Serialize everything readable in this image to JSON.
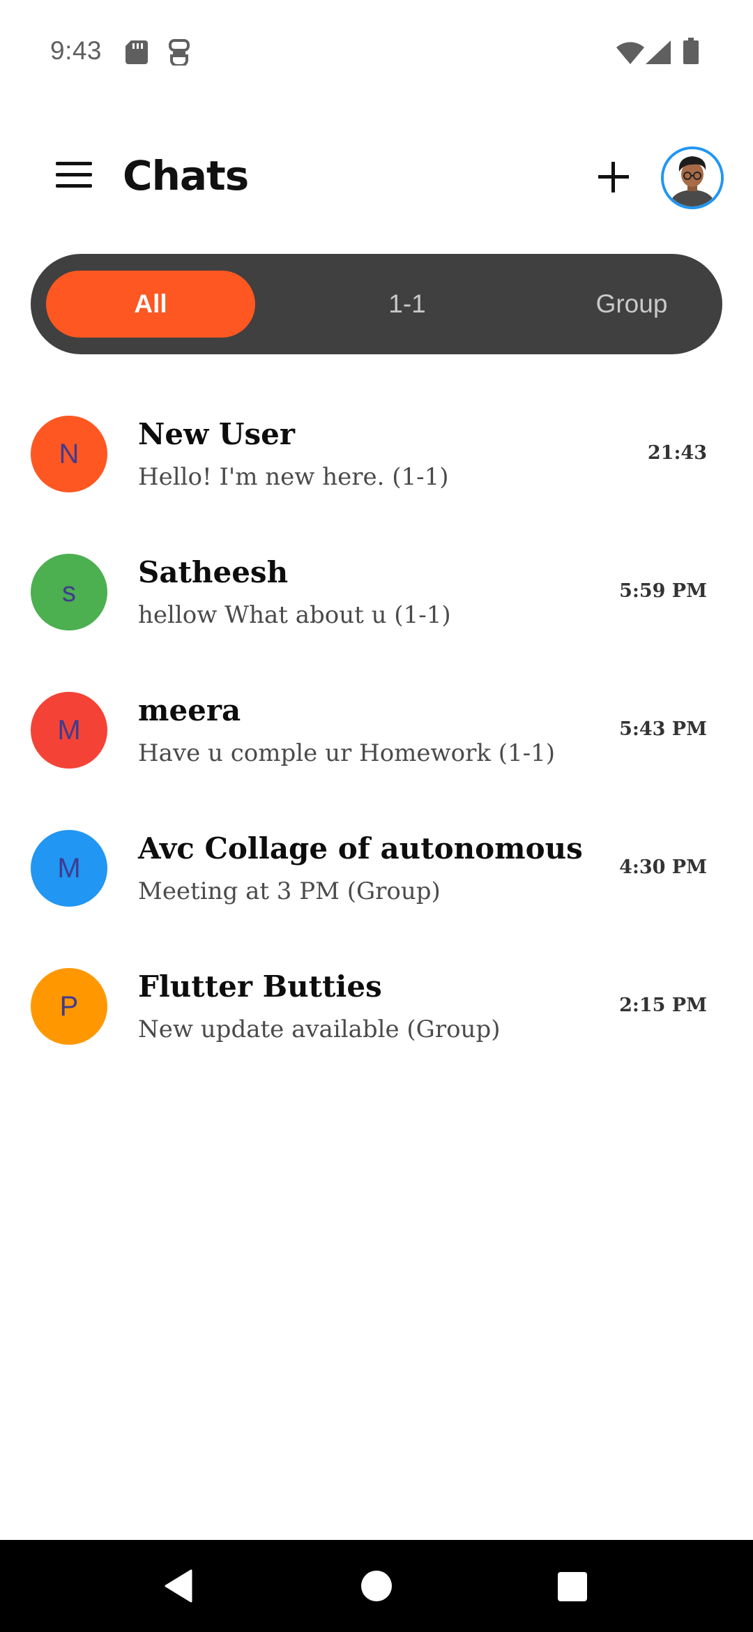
{
  "status_bar": {
    "time": "9:43",
    "icons": [
      "sd-card-icon",
      "robot-icon",
      "wifi-icon",
      "signal-icon",
      "battery-icon"
    ]
  },
  "app_bar": {
    "title": "Chats",
    "menu_icon": "menu-icon",
    "add_icon": "add-icon",
    "profile_icon": "profile-avatar"
  },
  "filter_tabs": {
    "all": "All",
    "one_to_one": "1-1",
    "group": "Group",
    "selected": "All"
  },
  "chats": [
    {
      "initial": "N",
      "name": "New User",
      "message": "Hello! I'm new here. (1-1)",
      "time": "21:43",
      "color": "#ff5722"
    },
    {
      "initial": "s",
      "name": "Satheesh",
      "message": "hellow What about u (1-1)",
      "time": "5:59 PM",
      "color": "#4caf50"
    },
    {
      "initial": "M",
      "name": "meera",
      "message": "Have u comple ur Homework (1-1)",
      "time": "5:43 PM",
      "color": "#f44336"
    },
    {
      "initial": "M",
      "name": "Avc Collage of autonomous",
      "message": "Meeting at 3 PM (Group)",
      "time": "4:30 PM",
      "color": "#2196f3"
    },
    {
      "initial": "P",
      "name": "Flutter Butties",
      "message": "New update available (Group)",
      "time": "2:15 PM",
      "color": "#ff9800"
    }
  ],
  "colors": {
    "accent": "#ff5722",
    "segment_bg": "#404040",
    "avatar_ring": "#2196f3",
    "initial_text": "#3f3c8f"
  },
  "nav_bar": {
    "icons": [
      "back-icon",
      "home-icon",
      "recents-icon"
    ]
  }
}
